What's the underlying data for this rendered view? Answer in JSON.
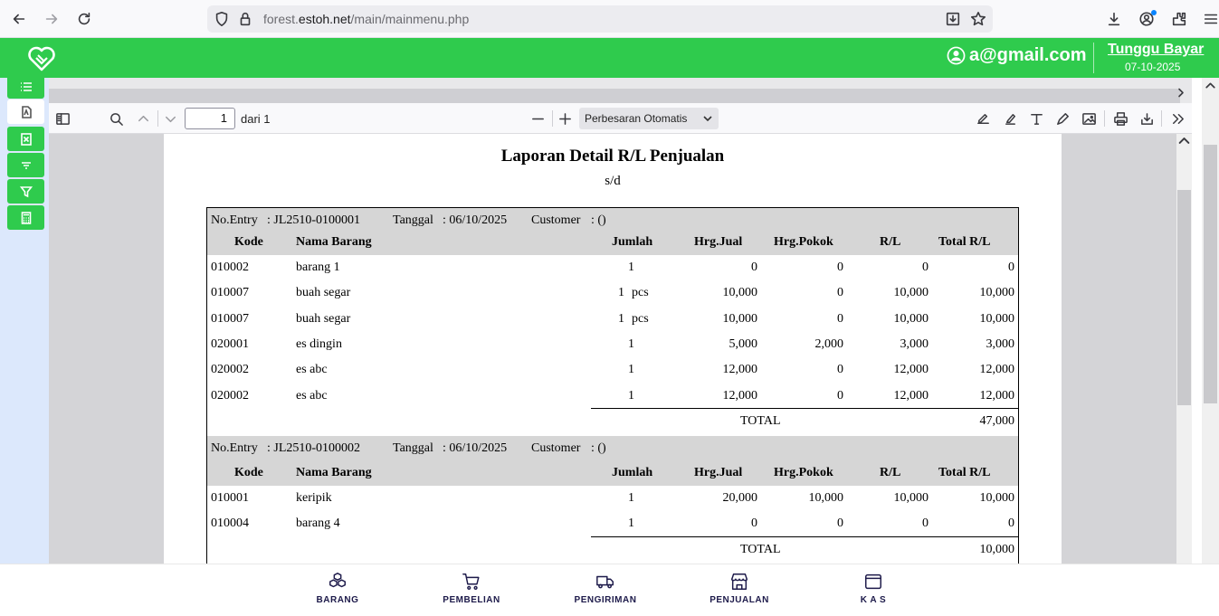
{
  "browser": {
    "url_prefix": "forest.",
    "url_domain": "estoh.net",
    "url_path": "/main/mainmenu.php"
  },
  "header": {
    "user_email": "a@gmail.com",
    "status_label": "Tunggu Bayar",
    "status_date": "07-10-2025",
    "accent_color": "#2fcb4d"
  },
  "pdf_toolbar": {
    "page_value": "1",
    "page_of": "dari 1",
    "zoom_label": "Perbesaran Otomatis"
  },
  "report": {
    "title": "Laporan Detail R/L Penjualan",
    "subtitle": "s/d",
    "columns": [
      "Kode",
      "Nama Barang",
      "Jumlah",
      "Hrg.Jual",
      "Hrg.Pokok",
      "R/L",
      "Total R/L"
    ],
    "entries": [
      {
        "entry_label": "No.Entry",
        "entry_value": ": JL2510-0100001",
        "date_label": "Tanggal",
        "date_value": ": 06/10/2025",
        "customer_label": "Customer",
        "customer_value": ": ()",
        "rows": [
          {
            "kode": "010002",
            "nama": "barang 1",
            "jumlah": "1",
            "satuan": "",
            "jual": "0",
            "pokok": "0",
            "rl": "0",
            "total": "0"
          },
          {
            "kode": "010007",
            "nama": "buah segar",
            "jumlah": "1",
            "satuan": "pcs",
            "jual": "10,000",
            "pokok": "0",
            "rl": "10,000",
            "total": "10,000"
          },
          {
            "kode": "010007",
            "nama": "buah segar",
            "jumlah": "1",
            "satuan": "pcs",
            "jual": "10,000",
            "pokok": "0",
            "rl": "10,000",
            "total": "10,000"
          },
          {
            "kode": "020001",
            "nama": "es dingin",
            "jumlah": "1",
            "satuan": "",
            "jual": "5,000",
            "pokok": "2,000",
            "rl": "3,000",
            "total": "3,000"
          },
          {
            "kode": "020002",
            "nama": "es abc",
            "jumlah": "1",
            "satuan": "",
            "jual": "12,000",
            "pokok": "0",
            "rl": "12,000",
            "total": "12,000"
          },
          {
            "kode": "020002",
            "nama": "es abc",
            "jumlah": "1",
            "satuan": "",
            "jual": "12,000",
            "pokok": "0",
            "rl": "12,000",
            "total": "12,000"
          }
        ],
        "total_label": "TOTAL",
        "total_value": "47,000"
      },
      {
        "entry_label": "No.Entry",
        "entry_value": ": JL2510-0100002",
        "date_label": "Tanggal",
        "date_value": ": 06/10/2025",
        "customer_label": "Customer",
        "customer_value": ": ()",
        "rows": [
          {
            "kode": "010001",
            "nama": "keripik",
            "jumlah": "1",
            "satuan": "",
            "jual": "20,000",
            "pokok": "10,000",
            "rl": "10,000",
            "total": "10,000"
          },
          {
            "kode": "010004",
            "nama": "barang 4",
            "jumlah": "1",
            "satuan": "",
            "jual": "0",
            "pokok": "0",
            "rl": "0",
            "total": "0"
          }
        ],
        "total_label": "TOTAL",
        "total_value": "10,000"
      }
    ]
  },
  "bottom_nav": [
    {
      "label": "BARANG",
      "icon": "boxes-icon"
    },
    {
      "label": "PEMBELIAN",
      "icon": "cart-icon"
    },
    {
      "label": "PENGIRIMAN",
      "icon": "truck-icon"
    },
    {
      "label": "PENJUALAN",
      "icon": "store-icon"
    },
    {
      "label": "K A S",
      "icon": "wallet-icon"
    }
  ]
}
